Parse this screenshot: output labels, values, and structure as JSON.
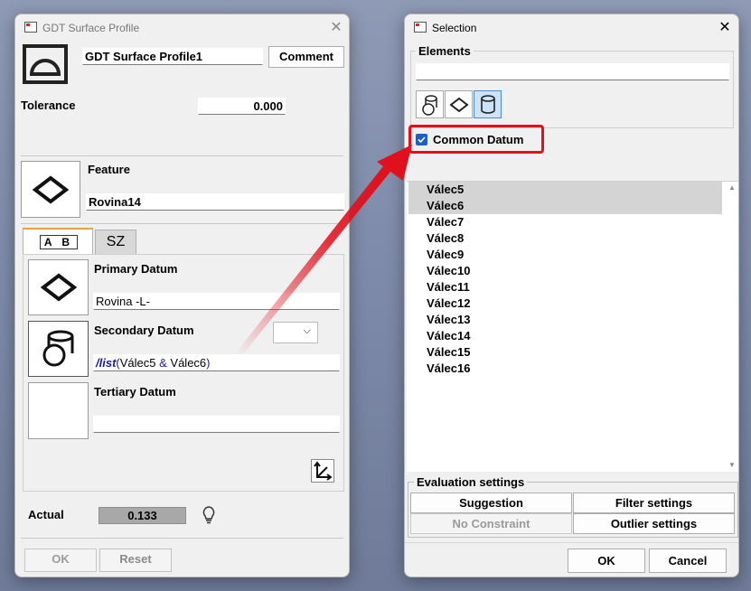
{
  "left_window": {
    "title": "GDT Surface Profile",
    "name_value": "GDT Surface Profile1",
    "comment_label": "Comment",
    "tolerance_label": "Tolerance",
    "tolerance_value": "0.000",
    "feature_label": "Feature",
    "feature_value": "Rovina14",
    "tabs": [
      {
        "label": "A B"
      },
      {
        "label": "SZ"
      }
    ],
    "primary_label": "Primary Datum",
    "primary_value": "Rovina -L-",
    "secondary_label": "Secondary Datum",
    "secondary_prefix": "/list",
    "secondary_paren_open": "(",
    "secondary_a": "Válec5",
    "secondary_amp": " & ",
    "secondary_b": "Válec6",
    "secondary_paren_close": ")",
    "tertiary_label": "Tertiary Datum",
    "tertiary_value": "",
    "actual_label": "Actual",
    "actual_value": "0.133",
    "ok_label": "OK",
    "reset_label": "Reset"
  },
  "right_window": {
    "title": "Selection",
    "elements_label": "Elements",
    "elements_value": "",
    "common_datum_label": "Common Datum",
    "common_datum_checked": true,
    "items": [
      {
        "label": "Válec5",
        "selected": true
      },
      {
        "label": "Válec6",
        "selected": true
      },
      {
        "label": "Válec7",
        "selected": false
      },
      {
        "label": "Válec8",
        "selected": false
      },
      {
        "label": "Válec9",
        "selected": false
      },
      {
        "label": "Válec10",
        "selected": false
      },
      {
        "label": "Válec11",
        "selected": false
      },
      {
        "label": "Válec12",
        "selected": false
      },
      {
        "label": "Válec13",
        "selected": false
      },
      {
        "label": "Válec14",
        "selected": false
      },
      {
        "label": "Válec15",
        "selected": false
      },
      {
        "label": "Válec16",
        "selected": false
      }
    ],
    "evaluation_label": "Evaluation settings",
    "suggestion_label": "Suggestion",
    "filter_label": "Filter settings",
    "no_constraint_label": "No Constraint",
    "outlier_label": "Outlier settings",
    "ok_label": "OK",
    "cancel_label": "Cancel"
  },
  "colors": {
    "highlight": "#e0101c",
    "checkbox": "#1f5fbf",
    "link_blue": "#1a1aa8",
    "actual_bg": "#a8a8a8"
  }
}
